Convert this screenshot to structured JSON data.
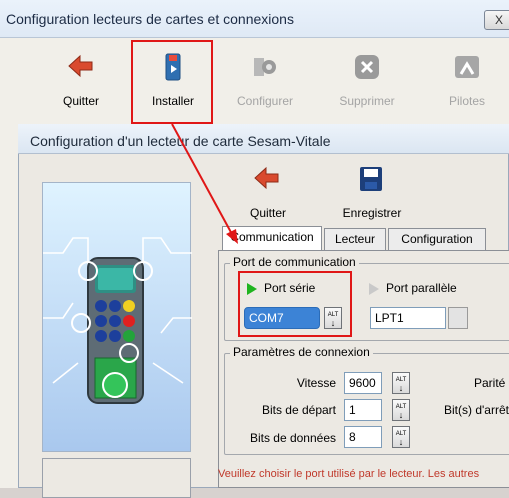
{
  "outer_window": {
    "title": "Configuration lecteurs de cartes et connexions",
    "close_label": "X",
    "toolbar": [
      {
        "label": "Quitter",
        "icon": "back-arrow-icon",
        "enabled": true
      },
      {
        "label": "Installer",
        "icon": "install-card-icon",
        "enabled": true
      },
      {
        "label": "Configurer",
        "icon": "configure-gear-icon",
        "enabled": false
      },
      {
        "label": "Supprimer",
        "icon": "delete-icon",
        "enabled": false
      },
      {
        "label": "Pilotes",
        "icon": "drivers-icon",
        "enabled": false
      }
    ]
  },
  "inner_dialog": {
    "title": "Configuration d'un lecteur de carte Sesam-Vitale",
    "toolbar": [
      {
        "label": "Quitter",
        "icon": "back-arrow-icon"
      },
      {
        "label": "Enregistrer",
        "icon": "save-disk-icon"
      }
    ],
    "tabs": [
      {
        "label": "Communication",
        "active": true
      },
      {
        "label": "Lecteur",
        "active": false
      },
      {
        "label": "Configuration",
        "active": false
      }
    ],
    "port_group": {
      "title": "Port de communication",
      "serial_label": "Port série",
      "serial_value": "COM7",
      "parallel_label": "Port parallèle",
      "parallel_value": "LPT1"
    },
    "conn_group": {
      "title": "Paramètres de connexion",
      "speed_label": "Vitesse",
      "speed_value": "9600",
      "start_bits_label": "Bits de départ",
      "start_bits_value": "1",
      "data_bits_label": "Bits de données",
      "data_bits_value": "8",
      "parity_label": "Parité",
      "stop_bits_label": "Bit(s) d'arrêt"
    },
    "alt_button_label": "ALT",
    "status_text": "Veuillez choisir le port utilisé par le lecteur. Les autres"
  },
  "colors": {
    "highlight": "#e01717",
    "selected_combo": "#3c83d6",
    "status_text": "#c0392b"
  }
}
